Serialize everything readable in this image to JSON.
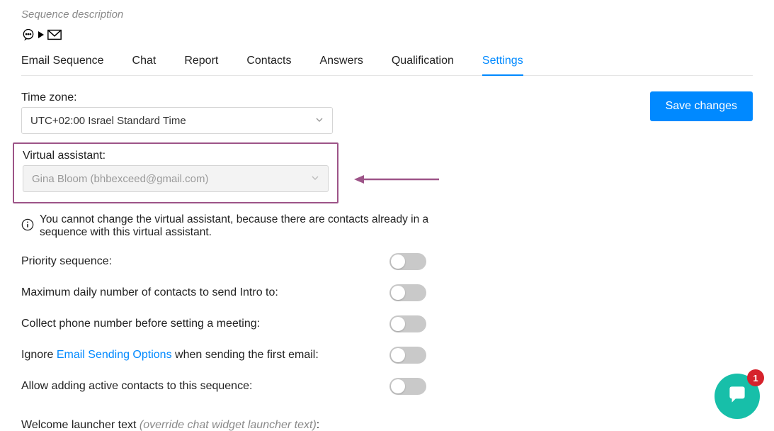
{
  "sequence_description_placeholder": "Sequence description",
  "tabs": [
    "Email Sequence",
    "Chat",
    "Report",
    "Contacts",
    "Answers",
    "Qualification",
    "Settings"
  ],
  "active_tab_index": 6,
  "save_button": "Save changes",
  "timezone": {
    "label": "Time zone:",
    "value": "UTC+02:00 Israel Standard Time"
  },
  "virtual_assistant": {
    "label": "Virtual assistant:",
    "value": "Gina Bloom (bhbexceed@gmail.com)",
    "info": "You cannot change the virtual assistant, because there are contacts already in a sequence with this virtual assistant."
  },
  "toggles": {
    "priority": "Priority sequence:",
    "max_daily": "Maximum daily number of contacts to send Intro to:",
    "collect_phone": "Collect phone number before setting a meeting:",
    "ignore_pre": "Ignore ",
    "ignore_link": "Email Sending Options",
    "ignore_post": " when sending the first email:",
    "allow_adding": "Allow adding active contacts to this sequence:"
  },
  "welcome": {
    "label": "Welcome launcher text ",
    "hint": "(override chat widget launcher text)",
    "colon": ":"
  },
  "chat_badge": "1"
}
